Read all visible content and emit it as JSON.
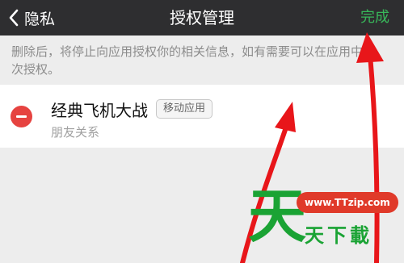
{
  "header": {
    "back_label": "隐私",
    "title": "授权管理",
    "done_label": "完成"
  },
  "notice": "删除后，将停止向应用授权你的相关信息，如有需要可以在应用中再次授权。",
  "app": {
    "name": "经典飞机大战",
    "tag": "移动应用",
    "permission": "朋友关系"
  },
  "watermark": {
    "big_char": "天",
    "url": "www.TTzip.com",
    "name": "天下載"
  },
  "colors": {
    "topbar": "#2e2e30",
    "done": "#38b75a",
    "remove": "#e64340",
    "arrow": "#e8161a",
    "watermark_green": "#1aa334"
  },
  "icons": {
    "back": "chevron-left-icon",
    "remove": "minus-circle-icon",
    "annotation": "red-arrow"
  }
}
